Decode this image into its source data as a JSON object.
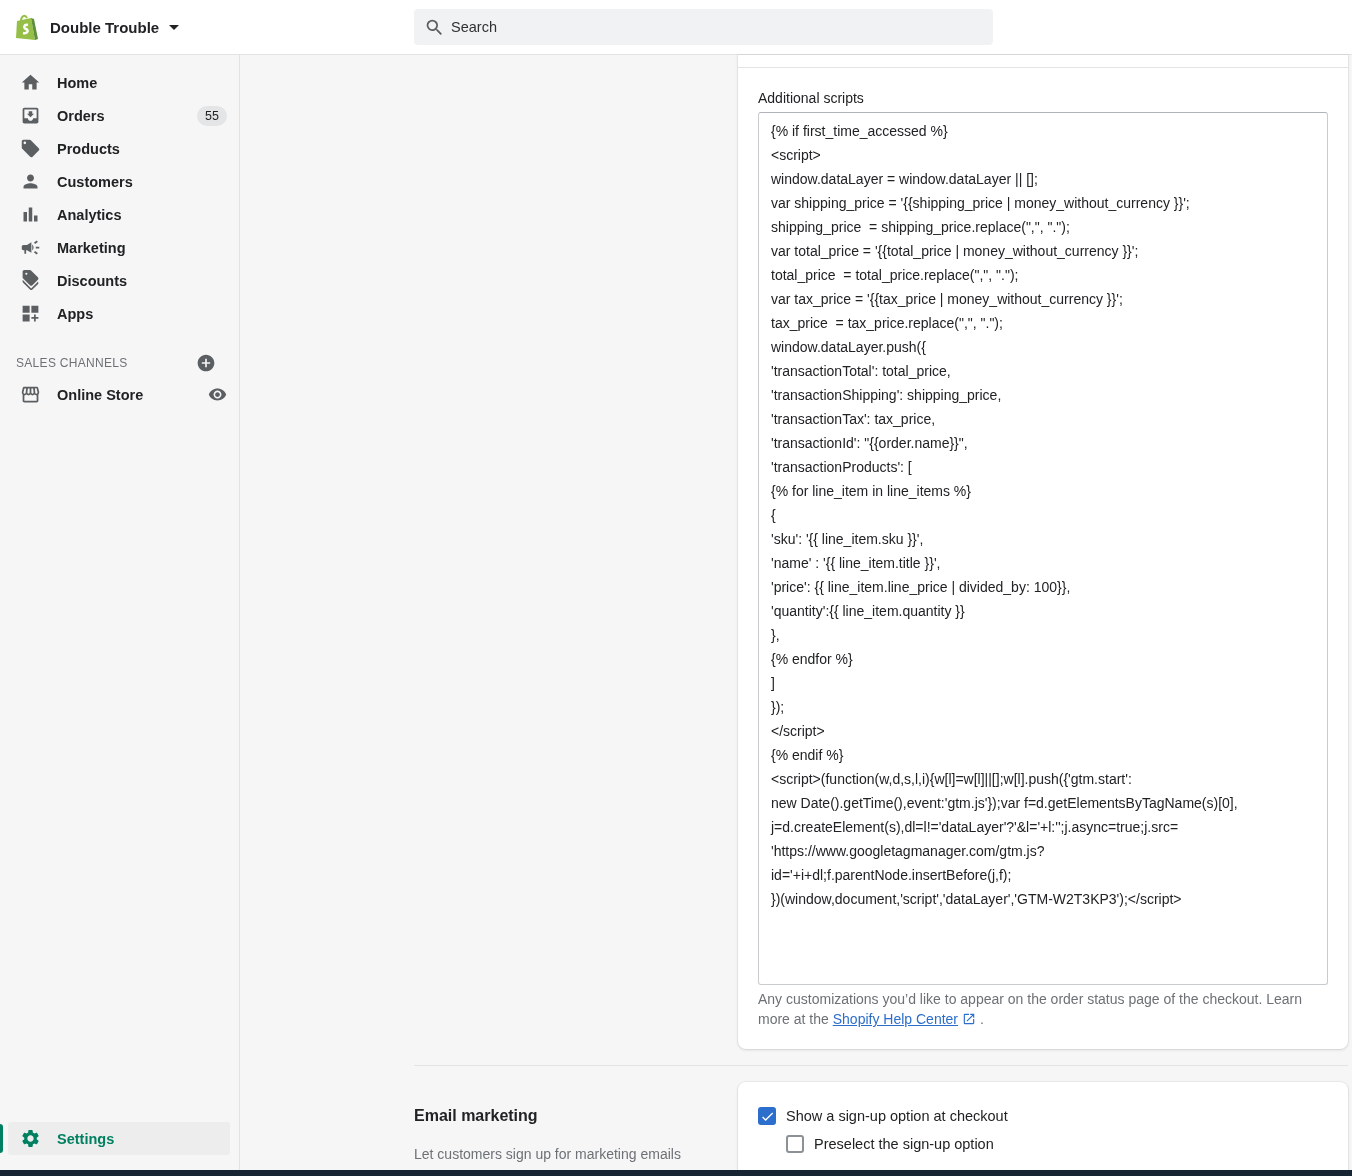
{
  "top_bar": {
    "store_name": "Double Trouble",
    "search": {
      "placeholder": "Search"
    }
  },
  "sidebar": {
    "items": [
      {
        "label": "Home",
        "kind": "home",
        "selected": false
      },
      {
        "label": "Orders",
        "kind": "orders",
        "selected": false,
        "badge": "55"
      },
      {
        "label": "Products",
        "kind": "tag",
        "selected": false
      },
      {
        "label": "Customers",
        "kind": "person",
        "selected": false
      },
      {
        "label": "Analytics",
        "kind": "chart",
        "selected": false
      },
      {
        "label": "Marketing",
        "kind": "megaphone",
        "selected": false
      },
      {
        "label": "Discounts",
        "kind": "discount",
        "selected": false
      },
      {
        "label": "Apps",
        "kind": "apps",
        "selected": false
      }
    ],
    "sales_channels": {
      "heading": "SALES CHANNELS",
      "items": [
        {
          "label": "Online Store",
          "kind": "store",
          "selected": false
        }
      ]
    },
    "settings": {
      "label": "Settings",
      "kind": "gear",
      "selected": true
    }
  },
  "additional_scripts": {
    "label": "Additional scripts",
    "lines": [
      "{% if first_time_accessed %}",
      "<script>",
      "window.dataLayer = window.dataLayer || [];",
      "var shipping_price = '{{shipping_price | money_without_currency }}';",
      "shipping_price  = shipping_price.replace(\",\", \".\");",
      "var total_price = '{{total_price | money_without_currency }}';",
      "total_price  = total_price.replace(\",\", \".\");",
      "var tax_price = '{{tax_price | money_without_currency }}';",
      "tax_price  = tax_price.replace(\",\", \".\");",
      "window.dataLayer.push({",
      "'transactionTotal': total_price,",
      "'transactionShipping': shipping_price,",
      "'transactionTax': tax_price,",
      "'transactionId': \"{{order.name}}\",",
      "'transactionProducts': [",
      "{% for line_item in line_items %}",
      "{",
      "'sku': '{{ line_item.sku }}',",
      "'name' : '{{ line_item.title }}',",
      "'price': {{ line_item.line_price | divided_by: 100}},",
      "'quantity':{{ line_item.quantity }}",
      "},",
      "{% endfor %}",
      "]",
      "});",
      "</script>",
      "{% endif %}",
      "<script>(function(w,d,s,l,i){w[l]=w[l]||[];w[l].push({'gtm.start':",
      "new Date().getTime(),event:'gtm.js'});var f=d.getElementsByTagName(s)[0],",
      "j=d.createElement(s),dl=l!='dataLayer'?'&l='+l:'';j.async=true;j.src=",
      "'https://www.googletagmanager.com/gtm.js?",
      "id='+i+dl;f.parentNode.insertBefore(j,f);",
      "})(window,document,'script','dataLayer','GTM-W2T3KP3');</script>"
    ],
    "help_text": "Any customizations you’d like to appear on the order status page of the checkout. Learn more at the",
    "help_link": "Shopify Help Center",
    "help_end": "."
  },
  "email_marketing": {
    "title": "Email marketing",
    "description": "Let customers sign up for marketing emails",
    "options": [
      {
        "label": "Show a sign-up option at checkout",
        "checked": true,
        "children": [
          {
            "label": "Preselect the sign-up option",
            "checked": false
          }
        ]
      }
    ]
  }
}
